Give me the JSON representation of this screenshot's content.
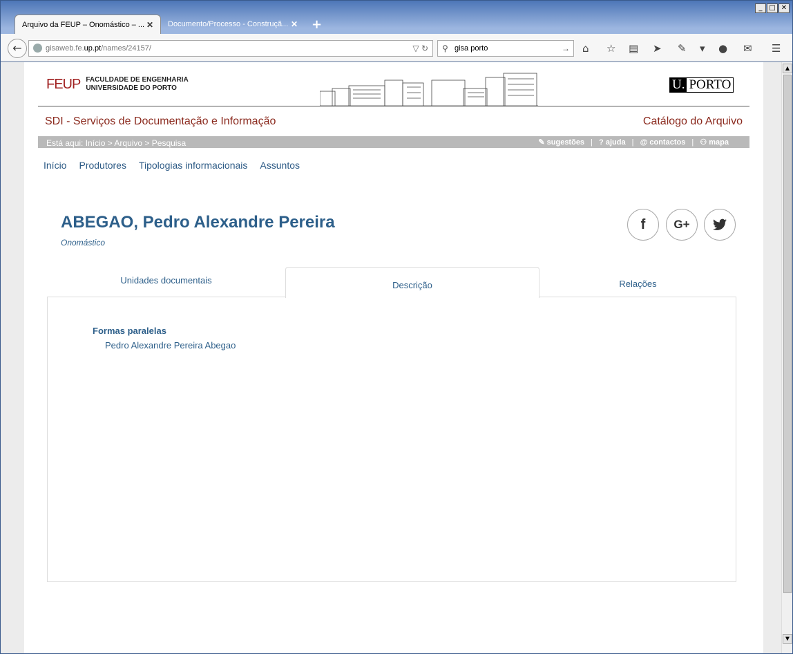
{
  "window": {
    "controls": [
      "_",
      "□",
      "✕"
    ]
  },
  "browser": {
    "tabs": [
      {
        "label": "Arquivo da FEUP – Onomástico – ...",
        "active": true
      },
      {
        "label": "Documento/Processo - Construçã...",
        "active": false
      }
    ],
    "url": {
      "prefix": "gisaweb.fe.",
      "domain": "up.pt",
      "path": "/names/24157/"
    },
    "search_value": "gisa porto"
  },
  "site": {
    "feup_mark": "FEUP",
    "feup_line1": "FACULDADE DE ENGENHARIA",
    "feup_line2": "UNIVERSIDADE DO PORTO",
    "uporto_u": "U.",
    "uporto_p": "PORTO",
    "sdi_title": "SDI - Serviços de Documentação e Informação",
    "catalog_title": "Catálogo do Arquivo",
    "breadcrumb": "Está aqui: Início > Arquivo > Pesquisa",
    "utility_links": [
      "sugestões",
      "ajuda",
      "contactos",
      "mapa"
    ],
    "menu": [
      "Início",
      "Produtores",
      "Tipologias informacionais",
      "Assuntos"
    ]
  },
  "record": {
    "name": "ABEGAO, Pedro Alexandre Pereira",
    "type": "Onomástico",
    "tabs": [
      "Unidades documentais",
      "Descrição",
      "Relações"
    ],
    "active_tab": "Descrição",
    "section_title": "Formas paralelas",
    "section_value": "Pedro Alexandre Pereira Abegao"
  },
  "social": {
    "facebook": "f",
    "google": "G+",
    "twitter": "t"
  },
  "colors": {
    "brand_red": "#8b2a1e",
    "link_blue": "#2d5f8a",
    "bar_gray": "#b9b9b9"
  }
}
